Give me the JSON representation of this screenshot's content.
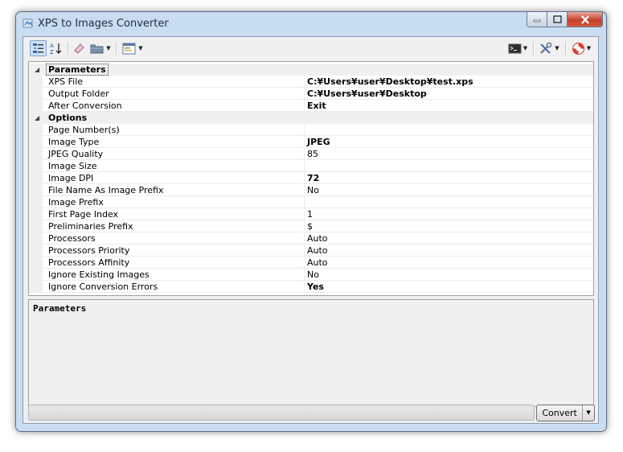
{
  "window": {
    "title": "XPS to Images Converter"
  },
  "icons": [
    "app-icon",
    "categorized-icon",
    "alphabetical-icon",
    "eraser-icon",
    "folder-icon",
    "properties-icon",
    "console-icon",
    "tools-icon",
    "help-icon"
  ],
  "property_grid": {
    "categories": [
      {
        "name": "Parameters",
        "properties": [
          {
            "name": "XPS File",
            "value": "C:¥Users¥user¥Desktop¥test.xps",
            "bold": true
          },
          {
            "name": "Output Folder",
            "value": "C:¥Users¥user¥Desktop",
            "bold": true
          },
          {
            "name": "After Conversion",
            "value": "Exit",
            "bold": true
          }
        ]
      },
      {
        "name": "Options",
        "properties": [
          {
            "name": "Page Number(s)",
            "value": "",
            "bold": false
          },
          {
            "name": "Image Type",
            "value": "JPEG",
            "bold": true
          },
          {
            "name": "JPEG Quality",
            "value": "85",
            "bold": false
          },
          {
            "name": "Image Size",
            "value": "",
            "bold": false
          },
          {
            "name": "Image DPI",
            "value": "72",
            "bold": true
          },
          {
            "name": "File Name As Image Prefix",
            "value": "No",
            "bold": false
          },
          {
            "name": "Image Prefix",
            "value": "",
            "bold": false
          },
          {
            "name": "First Page Index",
            "value": "1",
            "bold": false
          },
          {
            "name": "Preliminaries Prefix",
            "value": "$",
            "bold": false
          },
          {
            "name": "Processors",
            "value": "Auto",
            "bold": false
          },
          {
            "name": "Processors Priority",
            "value": "Auto",
            "bold": false
          },
          {
            "name": "Processors Affinity",
            "value": "Auto",
            "bold": false
          },
          {
            "name": "Ignore Existing Images",
            "value": "No",
            "bold": false
          },
          {
            "name": "Ignore Conversion Errors",
            "value": "Yes",
            "bold": true
          }
        ]
      }
    ]
  },
  "description": {
    "title": "Parameters"
  },
  "buttons": {
    "convert": "Convert"
  }
}
